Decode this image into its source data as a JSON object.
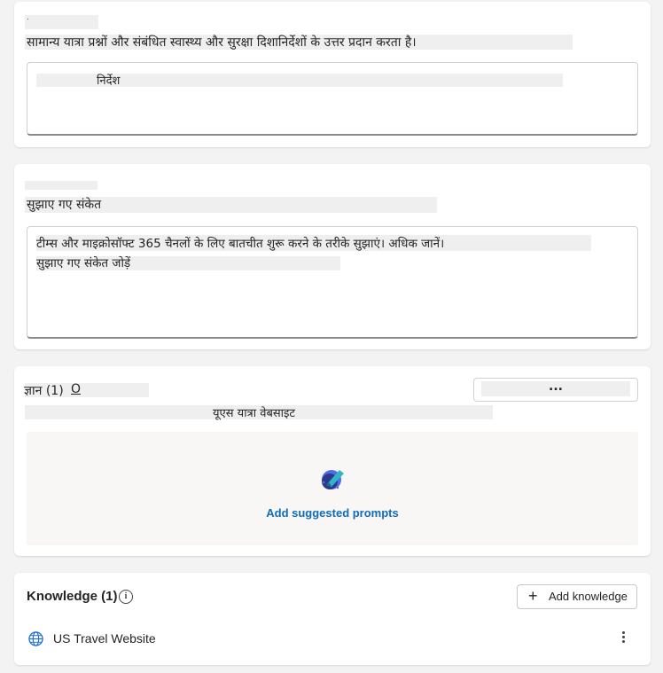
{
  "card1": {
    "small_label": ".",
    "description": "सामान्य यात्रा प्रश्नों और संबंधित स्वास्थ्य और सुरक्षा दिशानिर्देशों के उत्तर प्रदान करता है।",
    "instructions_label": "निर्देश"
  },
  "card2": {
    "heading": "सुझाए गए संकेत",
    "body_line1": "टीम्स और माइक्रोसॉफ्ट 365 चैनलों के लिए बातचीत शुरू करने के तरीके सुझाएं। अधिक जानें।",
    "body_line2": "सुझाए गए संकेत जोड़ें"
  },
  "card3": {
    "knowledge_label": "ज्ञान (1)",
    "knowledge_marker": "O",
    "more_label": "...",
    "website_label": "यूएस यात्रा वेबसाइट",
    "add_prompts_label": "Add suggested prompts"
  },
  "card4": {
    "title": "Knowledge (1)",
    "info_icon": "i",
    "add_button_label": "Add knowledge",
    "add_button_icon": "+",
    "site_name": "US Travel Website"
  },
  "colors": {
    "accent": "#0f6cbd",
    "background": "#f3f3f3",
    "card": "#ffffff"
  },
  "icons": {
    "badge": "suggested-prompts-badge-icon",
    "globe": "globe-icon",
    "kebab": "more-vertical-icon",
    "info": "info-icon"
  }
}
